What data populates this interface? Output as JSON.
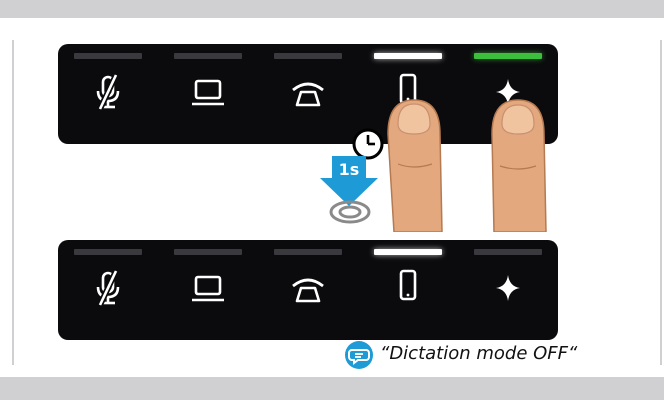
{
  "timer_label": "1s",
  "caption": "“Dictation mode OFF“",
  "colors": {
    "panel": "#0b0b0d",
    "led_off": "#3a3a3e",
    "led_white": "#ffffff",
    "led_green": "#3cbf3c",
    "arrow": "#1e9ad6",
    "speech_bubble": "#1e9ad6",
    "finger": "#e3a87e"
  },
  "panels": [
    {
      "state": "before",
      "buttons": [
        {
          "icon": "mic-mute-icon",
          "led": "off"
        },
        {
          "icon": "laptop-icon",
          "led": "off"
        },
        {
          "icon": "phone-handset-icon",
          "led": "off"
        },
        {
          "icon": "smartphone-icon",
          "led": "white"
        },
        {
          "icon": "sparkle-icon",
          "led": "green"
        }
      ]
    },
    {
      "state": "after",
      "buttons": [
        {
          "icon": "mic-mute-icon",
          "led": "off"
        },
        {
          "icon": "laptop-icon",
          "led": "off"
        },
        {
          "icon": "phone-handset-icon",
          "led": "off"
        },
        {
          "icon": "smartphone-icon",
          "led": "white"
        },
        {
          "icon": "sparkle-icon",
          "led": "off"
        }
      ]
    }
  ]
}
